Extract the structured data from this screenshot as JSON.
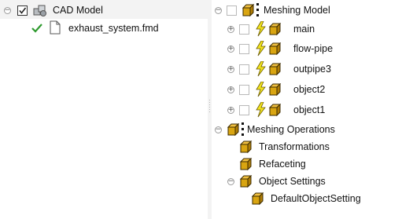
{
  "left_tree": {
    "root": {
      "label": "CAD Model",
      "checked": true,
      "expander": "−"
    },
    "file": {
      "label": "exhaust_system.fmd",
      "status_icon": "check-icon"
    }
  },
  "right_tree": {
    "meshing_model": {
      "label": "Meshing Model",
      "expander": "−",
      "children": [
        {
          "label": "main",
          "expander": "+"
        },
        {
          "label": "flow-pipe",
          "expander": "+"
        },
        {
          "label": "outpipe3",
          "expander": "+"
        },
        {
          "label": "object2",
          "expander": "+"
        },
        {
          "label": "object1",
          "expander": "+"
        }
      ]
    },
    "meshing_operations": {
      "label": "Meshing Operations",
      "expander": "−",
      "children": [
        {
          "label": "Transformations"
        },
        {
          "label": "Refaceting"
        },
        {
          "label": "Object Settings",
          "expander": "−",
          "children": [
            {
              "label": "DefaultObjectSetting"
            }
          ]
        }
      ]
    }
  },
  "colors": {
    "cube_fill": "#d9a511",
    "cube_stroke": "#3b2a00",
    "bolt": "#f2e41c",
    "check": "#2e9a2e",
    "selection_band": "#f3f3f3"
  }
}
